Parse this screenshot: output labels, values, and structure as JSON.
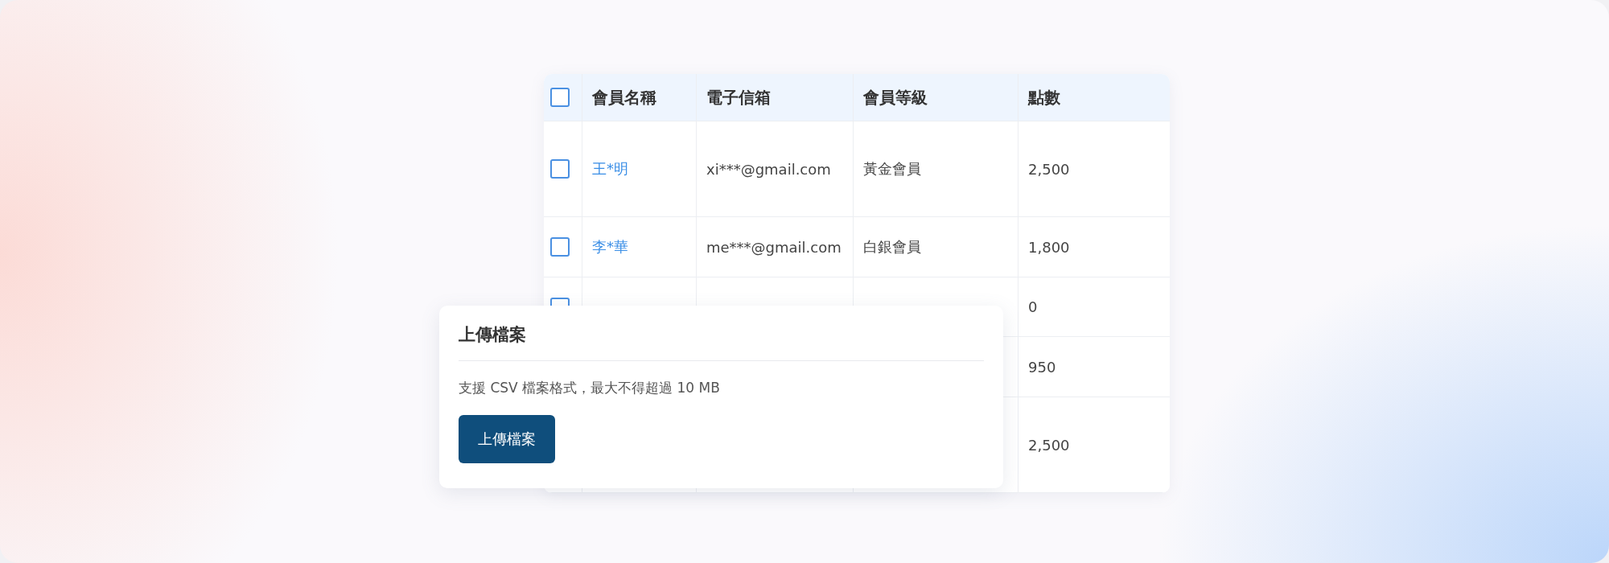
{
  "table": {
    "header_checked": false,
    "columns": [
      "會員名稱",
      "電子信箱",
      "會員等級",
      "點數"
    ],
    "rows": [
      {
        "checked": false,
        "name": "王*明",
        "email": "xi***@gmail.com",
        "level": "黃金會員",
        "points": "2,500"
      },
      {
        "checked": false,
        "name": "李*華",
        "email": "me***@gmail.com",
        "level": "白銀會員",
        "points": "1,800"
      },
      {
        "checked": false,
        "points": "0"
      },
      {
        "points": "950"
      },
      {
        "points": "2,500"
      }
    ]
  },
  "upload_card": {
    "title": "上傳檔案",
    "description": "支援 CSV 檔案格式，最大不得超過 10 MB",
    "button": "上傳檔案"
  }
}
